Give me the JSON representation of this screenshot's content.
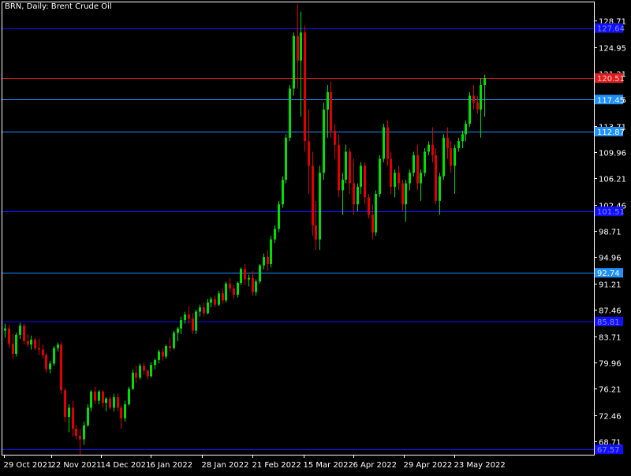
{
  "chart_data": {
    "type": "candlestick",
    "symbol": "BRN",
    "timeframe": "Daily",
    "description": "Brent Crude Oil",
    "title": "BRN, Daily:  Brent Crude Oil",
    "ylim": [
      66.8,
      131.3
    ],
    "y_ticks": [
      "128.71",
      "124.95",
      "121.21",
      "117.45",
      "113.71",
      "109.96",
      "106.21",
      "102.46",
      "98.71",
      "94.96",
      "91.21",
      "87.46",
      "83.71",
      "79.96",
      "76.21",
      "72.46",
      "68.71"
    ],
    "x_ticks": [
      "29 Oct 2021",
      "22 Nov 2021",
      "14 Dec 2021",
      "6 Jan 2022",
      "28 Jan 2022",
      "21 Feb 2022",
      "15 Mar 2022",
      "6 Apr 2022",
      "29 Apr 2022",
      "23 May 2022"
    ],
    "horizontal_levels": [
      {
        "value": 127.64,
        "label": "127.64",
        "color": "#1010ff",
        "label_bg": "#1010ff",
        "label_fg": "#8888ff"
      },
      {
        "value": 120.51,
        "label": "120.51",
        "color": "#d01c1c",
        "label_bg": "#e01c1c",
        "label_fg": "#ffd0d0"
      },
      {
        "value": 117.45,
        "label": "117.45",
        "color": "#1e90ff",
        "label_bg": "#1e90ff",
        "label_fg": "#ffffff"
      },
      {
        "value": 112.87,
        "label": "112.87",
        "color": "#1e90ff",
        "label_bg": "#1e90ff",
        "label_fg": "#ffffff"
      },
      {
        "value": 101.51,
        "label": "101.51",
        "color": "#1010ff",
        "label_bg": "#1010ff",
        "label_fg": "#8888ff"
      },
      {
        "value": 92.74,
        "label": "92.74",
        "color": "#1e90ff",
        "label_bg": "#1e90ff",
        "label_fg": "#ffffff"
      },
      {
        "value": 85.81,
        "label": "85.81",
        "color": "#1010ff",
        "label_bg": "#1010ff",
        "label_fg": "#8888ff"
      },
      {
        "value": 67.57,
        "label": "67.57",
        "color": "#1010ff",
        "label_bg": "#1010ff",
        "label_fg": "#8888ff"
      }
    ],
    "colors": {
      "bull": "#00e000",
      "bear": "#e00000",
      "axis": "#ffffff",
      "background": "#000000"
    },
    "candles": [
      [
        84.5,
        85.5,
        83.5,
        84.8
      ],
      [
        84.8,
        85.3,
        82.0,
        82.6
      ],
      [
        82.6,
        84.0,
        80.5,
        81.2
      ],
      [
        81.2,
        84.2,
        80.8,
        83.9
      ],
      [
        83.9,
        85.6,
        83.3,
        85.2
      ],
      [
        85.2,
        85.5,
        82.5,
        83.0
      ],
      [
        83.0,
        84.0,
        82.2,
        82.5
      ],
      [
        82.5,
        83.8,
        81.8,
        83.2
      ],
      [
        83.2,
        83.5,
        81.7,
        82.0
      ],
      [
        82.0,
        83.4,
        81.0,
        81.8
      ],
      [
        81.8,
        82.5,
        80.5,
        81.0
      ],
      [
        81.0,
        81.3,
        78.5,
        79.0
      ],
      [
        79.0,
        80.2,
        78.4,
        79.8
      ],
      [
        79.8,
        82.3,
        79.5,
        82.0
      ],
      [
        82.0,
        82.8,
        81.5,
        82.5
      ],
      [
        82.5,
        82.9,
        75.5,
        76.0
      ],
      [
        76.0,
        76.3,
        71.5,
        72.2
      ],
      [
        72.2,
        74.0,
        70.0,
        73.5
      ],
      [
        73.5,
        74.5,
        69.4,
        70.5
      ],
      [
        70.5,
        71.0,
        69.0,
        69.5
      ],
      [
        69.5,
        70.5,
        66.8,
        69.0
      ],
      [
        69.0,
        71.5,
        68.2,
        71.0
      ],
      [
        71.0,
        74.0,
        70.8,
        73.5
      ],
      [
        73.5,
        76.0,
        73.0,
        75.8
      ],
      [
        75.8,
        76.5,
        74.0,
        74.5
      ],
      [
        74.5,
        76.0,
        74.0,
        75.8
      ],
      [
        75.8,
        76.0,
        73.5,
        74.2
      ],
      [
        74.2,
        75.0,
        73.0,
        74.8
      ],
      [
        74.8,
        75.2,
        73.2,
        73.5
      ],
      [
        73.5,
        75.5,
        73.0,
        75.0
      ],
      [
        75.0,
        75.5,
        73.0,
        73.5
      ],
      [
        73.5,
        73.8,
        70.5,
        72.0
      ],
      [
        72.0,
        74.5,
        71.5,
        74.0
      ],
      [
        74.0,
        76.5,
        73.8,
        76.2
      ],
      [
        76.2,
        79.0,
        76.0,
        78.5
      ],
      [
        78.5,
        79.5,
        77.0,
        77.8
      ],
      [
        77.8,
        79.8,
        77.5,
        79.5
      ],
      [
        79.5,
        80.0,
        78.2,
        78.8
      ],
      [
        78.8,
        79.0,
        77.5,
        78.0
      ],
      [
        78.0,
        80.0,
        77.8,
        79.6
      ],
      [
        79.6,
        80.5,
        79.0,
        80.3
      ],
      [
        80.3,
        81.8,
        79.8,
        81.5
      ],
      [
        81.5,
        82.0,
        80.2,
        80.8
      ],
      [
        80.8,
        82.5,
        80.5,
        82.3
      ],
      [
        82.3,
        83.5,
        81.5,
        82.0
      ],
      [
        82.0,
        84.5,
        81.8,
        84.2
      ],
      [
        84.2,
        85.0,
        83.0,
        84.8
      ],
      [
        84.8,
        86.5,
        84.0,
        86.0
      ],
      [
        86.0,
        87.2,
        85.5,
        86.8
      ],
      [
        86.8,
        88.0,
        85.5,
        86.2
      ],
      [
        86.2,
        87.0,
        84.0,
        84.5
      ],
      [
        84.5,
        87.5,
        84.0,
        87.2
      ],
      [
        87.2,
        88.2,
        86.5,
        87.8
      ],
      [
        87.8,
        88.5,
        86.5,
        87.0
      ],
      [
        87.0,
        89.0,
        86.8,
        88.5
      ],
      [
        88.5,
        89.3,
        87.8,
        89.0
      ],
      [
        89.0,
        89.5,
        87.8,
        88.2
      ],
      [
        88.2,
        90.2,
        88.0,
        89.8
      ],
      [
        89.8,
        90.5,
        88.3,
        88.8
      ],
      [
        88.8,
        91.5,
        88.5,
        91.2
      ],
      [
        91.2,
        92.0,
        90.0,
        90.5
      ],
      [
        90.5,
        91.0,
        89.0,
        89.6
      ],
      [
        89.6,
        91.5,
        89.2,
        91.3
      ],
      [
        91.3,
        93.5,
        91.0,
        93.3
      ],
      [
        93.3,
        94.0,
        91.0,
        91.8
      ],
      [
        91.8,
        92.5,
        90.8,
        92.0
      ],
      [
        92.0,
        93.0,
        89.5,
        90.0
      ],
      [
        90.0,
        91.8,
        89.5,
        91.5
      ],
      [
        91.5,
        94.0,
        91.2,
        93.8
      ],
      [
        93.8,
        95.5,
        93.2,
        95.0
      ],
      [
        95.0,
        96.0,
        93.0,
        94.0
      ],
      [
        94.0,
        98.0,
        93.5,
        97.5
      ],
      [
        97.5,
        99.5,
        97.0,
        99.0
      ],
      [
        99.0,
        103.0,
        98.5,
        102.5
      ],
      [
        102.5,
        106.5,
        102.0,
        106.0
      ],
      [
        106.0,
        112.5,
        105.5,
        112.0
      ],
      [
        112.0,
        119.5,
        111.5,
        119.0
      ],
      [
        119.0,
        127.0,
        118.0,
        126.5
      ],
      [
        126.5,
        131.0,
        119.0,
        123.0
      ],
      [
        123.0,
        130.0,
        115.0,
        127.0
      ],
      [
        127.0,
        128.0,
        110.0,
        111.5
      ],
      [
        111.5,
        116.0,
        104.0,
        108.0
      ],
      [
        108.0,
        110.0,
        98.0,
        99.5
      ],
      [
        99.5,
        103.0,
        96.0,
        97.5
      ],
      [
        97.5,
        108.0,
        96.0,
        107.0
      ],
      [
        107.0,
        117.0,
        106.0,
        116.0
      ],
      [
        116.0,
        119.5,
        112.0,
        118.5
      ],
      [
        118.5,
        120.0,
        112.0,
        113.0
      ],
      [
        113.0,
        114.0,
        109.0,
        111.0
      ],
      [
        111.0,
        112.5,
        103.5,
        104.5
      ],
      [
        104.5,
        107.0,
        101.0,
        106.0
      ],
      [
        106.0,
        111.0,
        105.5,
        110.0
      ],
      [
        110.0,
        110.5,
        104.0,
        105.5
      ],
      [
        105.5,
        109.0,
        101.0,
        102.5
      ],
      [
        102.5,
        105.5,
        101.5,
        105.0
      ],
      [
        105.0,
        108.5,
        104.0,
        108.0
      ],
      [
        108.0,
        108.5,
        102.5,
        103.5
      ],
      [
        103.5,
        104.0,
        100.5,
        101.0
      ],
      [
        101.0,
        102.5,
        97.5,
        98.5
      ],
      [
        98.5,
        104.5,
        98.0,
        104.0
      ],
      [
        104.0,
        109.5,
        103.5,
        109.0
      ],
      [
        109.0,
        114.0,
        108.5,
        113.5
      ],
      [
        113.5,
        114.5,
        108.0,
        109.0
      ],
      [
        109.0,
        110.0,
        104.0,
        105.0
      ],
      [
        105.0,
        107.5,
        103.5,
        107.0
      ],
      [
        107.0,
        108.0,
        104.5,
        105.5
      ],
      [
        105.5,
        106.0,
        101.5,
        102.5
      ],
      [
        102.5,
        106.0,
        100.0,
        105.5
      ],
      [
        105.5,
        107.5,
        104.5,
        107.0
      ],
      [
        107.0,
        110.0,
        106.5,
        109.5
      ],
      [
        109.5,
        111.0,
        104.5,
        105.5
      ],
      [
        105.5,
        107.5,
        103.0,
        107.0
      ],
      [
        107.0,
        110.5,
        106.5,
        110.0
      ],
      [
        110.0,
        111.5,
        109.5,
        111.0
      ],
      [
        111.0,
        113.5,
        108.5,
        109.5
      ],
      [
        109.5,
        110.5,
        102.5,
        103.0
      ],
      [
        103.0,
        107.0,
        101.0,
        106.5
      ],
      [
        106.5,
        112.5,
        106.0,
        112.0
      ],
      [
        112.0,
        113.5,
        109.0,
        110.5
      ],
      [
        110.5,
        111.5,
        107.0,
        108.0
      ],
      [
        108.0,
        111.0,
        104.0,
        110.5
      ],
      [
        110.5,
        112.0,
        110.0,
        111.5
      ],
      [
        111.5,
        113.0,
        110.5,
        112.5
      ],
      [
        112.5,
        114.5,
        111.5,
        114.0
      ],
      [
        114.0,
        118.5,
        113.5,
        118.0
      ],
      [
        118.0,
        119.5,
        116.0,
        117.0
      ],
      [
        117.0,
        118.0,
        115.5,
        116.0
      ],
      [
        116.0,
        120.5,
        112.0,
        119.5
      ],
      [
        119.5,
        121.0,
        115.0,
        120.5
      ]
    ]
  }
}
